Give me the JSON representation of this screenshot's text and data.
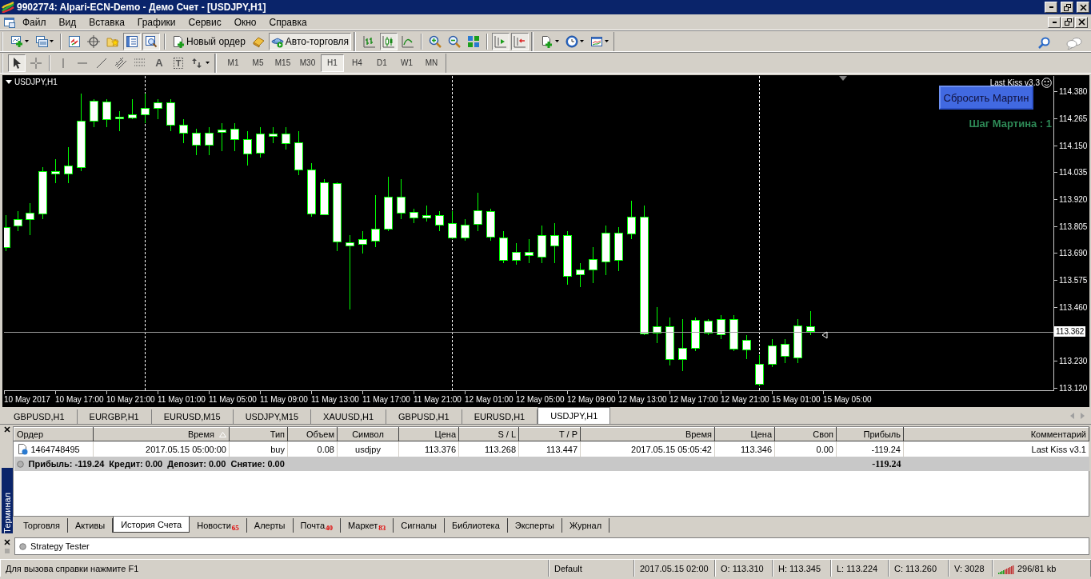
{
  "window": {
    "title": "9902774: Alpari-ECN-Demo - Демо Счет - [USDJPY,H1]"
  },
  "menu": [
    "Файл",
    "Вид",
    "Вставка",
    "Графики",
    "Сервис",
    "Окно",
    "Справка"
  ],
  "toolbar": {
    "groups": [
      [
        {
          "kind": "icon",
          "pressed": false
        },
        {
          "kind": "icon",
          "pressed": false
        }
      ],
      [
        {
          "kind": "icon",
          "pressed": false
        },
        {
          "kind": "icon",
          "pressed": false
        },
        {
          "kind": "icon",
          "pressed": false
        },
        {
          "kind": "icon",
          "pressed": true
        },
        {
          "kind": "icon",
          "pressed": true
        }
      ],
      [
        {
          "kind": "button",
          "label": "Новый ордер",
          "pressed": false
        },
        {
          "kind": "icon",
          "pressed": false
        },
        {
          "kind": "button",
          "label": "Авто-торговля",
          "pressed": true
        }
      ],
      [
        {
          "kind": "icon",
          "pressed": false
        },
        {
          "kind": "icon",
          "pressed": true
        },
        {
          "kind": "icon",
          "pressed": false
        }
      ],
      [
        {
          "kind": "icon",
          "pressed": false
        },
        {
          "kind": "icon",
          "pressed": false
        },
        {
          "kind": "icon",
          "pressed": false
        }
      ],
      [
        {
          "kind": "icon",
          "pressed": true
        },
        {
          "kind": "icon",
          "pressed": true
        }
      ],
      [
        {
          "kind": "icon",
          "pressed": false
        },
        {
          "kind": "icon",
          "pressed": false
        },
        {
          "kind": "icon",
          "pressed": false
        }
      ]
    ]
  },
  "drawing_toolbar": {
    "groups": [
      [
        {
          "kind": "icon",
          "pressed": true
        },
        {
          "kind": "icon",
          "pressed": false
        }
      ],
      [
        {
          "kind": "icon",
          "pressed": false
        },
        {
          "kind": "icon",
          "pressed": false
        },
        {
          "kind": "icon",
          "pressed": false
        },
        {
          "kind": "icon",
          "pressed": false
        },
        {
          "kind": "icon",
          "pressed": false
        },
        {
          "kind": "glyph",
          "glyph": "A",
          "pressed": false
        },
        {
          "kind": "glyph",
          "glyph": "T",
          "pressed": false
        },
        {
          "kind": "icon",
          "pressed": false
        }
      ]
    ],
    "timeframes": [
      {
        "label": "M1",
        "selected": false
      },
      {
        "label": "M5",
        "selected": false
      },
      {
        "label": "M15",
        "selected": false
      },
      {
        "label": "M30",
        "selected": false
      },
      {
        "label": "H1",
        "selected": true
      },
      {
        "label": "H4",
        "selected": false
      },
      {
        "label": "D1",
        "selected": false
      },
      {
        "label": "W1",
        "selected": false
      },
      {
        "label": "MN",
        "selected": false
      }
    ]
  },
  "chart": {
    "symbol": "USDJPY,H1",
    "expert": "Last Kiss v3.3",
    "reset_button": "Сбросить Мартин",
    "martin_step": "Шаг Мартина : 1",
    "price_labels": [
      "114.380",
      "114.265",
      "114.150",
      "114.035",
      "113.920",
      "113.805",
      "113.690",
      "113.575",
      "113.460",
      "113.230",
      "113.120"
    ],
    "current_price": "113.362",
    "time_labels": [
      "10 May 2017",
      "10 May 17:00",
      "10 May 21:00",
      "11 May 01:00",
      "11 May 05:00",
      "11 May 09:00",
      "11 May 13:00",
      "11 May 17:00",
      "11 May 21:00",
      "12 May 01:00",
      "12 May 05:00",
      "12 May 09:00",
      "12 May 13:00",
      "12 May 17:00",
      "12 May 21:00",
      "15 May 01:00",
      "15 May 05:00"
    ]
  },
  "chart_tabs": [
    {
      "label": "GBPUSD,H1",
      "selected": false
    },
    {
      "label": "EURGBP,H1",
      "selected": false
    },
    {
      "label": "EURUSD,M15",
      "selected": false
    },
    {
      "label": "USDJPY,M15",
      "selected": false
    },
    {
      "label": "XAUUSD,H1",
      "selected": false
    },
    {
      "label": "GBPUSD,H1",
      "selected": false
    },
    {
      "label": "EURUSD,H1",
      "selected": false
    },
    {
      "label": "USDJPY,H1",
      "selected": true
    }
  ],
  "terminal": {
    "title": "Терминал",
    "columns": [
      {
        "label": "Ордер",
        "sorted": false
      },
      {
        "label": "Время",
        "sorted": true
      },
      {
        "label": "Тип",
        "sorted": false
      },
      {
        "label": "Объем",
        "sorted": false
      },
      {
        "label": "Символ",
        "sorted": false
      },
      {
        "label": "Цена",
        "sorted": false
      },
      {
        "label": "S / L",
        "sorted": false
      },
      {
        "label": "T / P",
        "sorted": false
      },
      {
        "label": "Время",
        "sorted": false
      },
      {
        "label": "Цена",
        "sorted": false
      },
      {
        "label": "Своп",
        "sorted": false
      },
      {
        "label": "Прибыль",
        "sorted": false
      },
      {
        "label": "Комментарий",
        "sorted": false
      }
    ],
    "rows": [
      {
        "cells": [
          "1464748495",
          "2017.05.15 05:00:00",
          "buy",
          "0.08",
          "usdjpy",
          "113.376",
          "113.268",
          "113.447",
          "2017.05.15 05:05:42",
          "113.346",
          "0.00",
          "-119.24",
          "Last Kiss v3.1"
        ]
      }
    ],
    "summary": {
      "text": "Прибыль: -119.24  Кредит: 0.00  Депозит: 0.00  Снятие: 0.00",
      "profit": "-119.24"
    },
    "tabs": [
      {
        "label": "Торговля",
        "selected": false
      },
      {
        "label": "Активы",
        "selected": false
      },
      {
        "label": "История Счета",
        "selected": true
      },
      {
        "label": "Новости",
        "badge": "65",
        "selected": false
      },
      {
        "label": "Алерты",
        "selected": false
      },
      {
        "label": "Почта",
        "badge": "40",
        "selected": false
      },
      {
        "label": "Маркет",
        "badge": "83",
        "selected": false
      },
      {
        "label": "Сигналы",
        "selected": false
      },
      {
        "label": "Библиотека",
        "selected": false
      },
      {
        "label": "Эксперты",
        "selected": false
      },
      {
        "label": "Журнал",
        "selected": false
      }
    ]
  },
  "strategy_tester": {
    "title": "Strategy Tester"
  },
  "status_bar": {
    "help": "Для вызова справки нажмите F1",
    "profile": "Default",
    "time": "2017.05.15 02:00",
    "open": "O: 113.310",
    "high": "H: 113.345",
    "low": "L: 113.224",
    "close": "C: 113.260",
    "volume": "V: 3028",
    "traffic": "296/81 kb"
  }
}
